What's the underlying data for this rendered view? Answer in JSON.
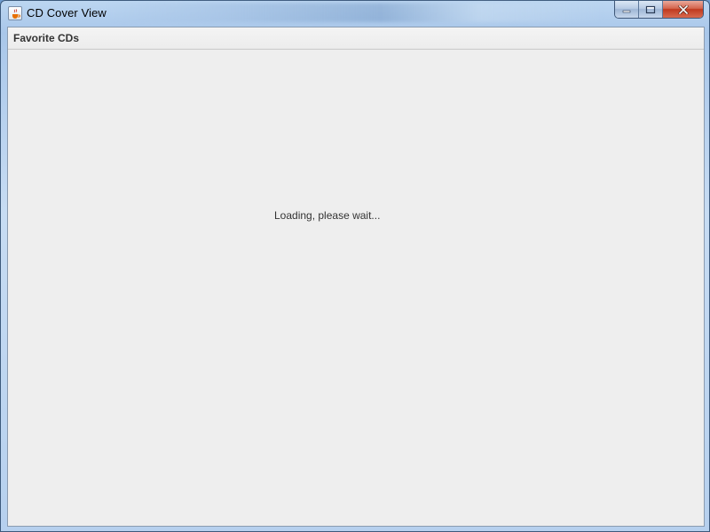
{
  "window": {
    "title": "CD Cover View",
    "icon": "java-cup-icon",
    "controls": [
      "minimize-icon",
      "maximize-icon",
      "close-icon"
    ]
  },
  "menu": {
    "items": [
      {
        "label": "Favorite CDs"
      }
    ]
  },
  "content": {
    "status": "Loading, please wait..."
  },
  "colors": {
    "client_bg": "#eeeeee",
    "frame": "#b6d0ee",
    "close_button": "#c0391f"
  }
}
